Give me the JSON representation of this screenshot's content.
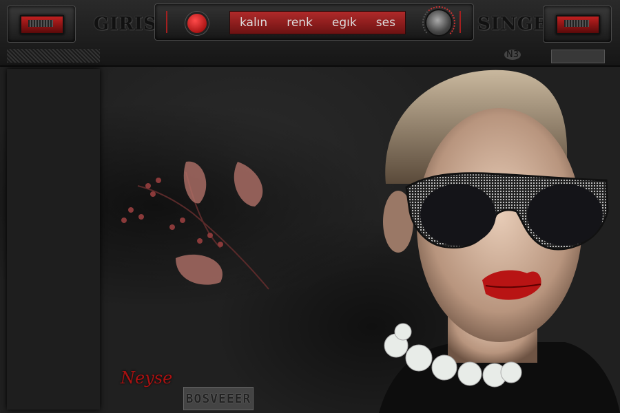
{
  "nav": {
    "left_label": "GIRIS",
    "right_label": "SINGE",
    "menu": [
      "kalın",
      "renk",
      "egık",
      "ses"
    ],
    "number_badge": "N3"
  },
  "artwork": {
    "signature": "Neyse",
    "logo_text": "BOSVEEER"
  },
  "colors": {
    "accent": "#b02a2a",
    "background": "#1b1b1b"
  }
}
